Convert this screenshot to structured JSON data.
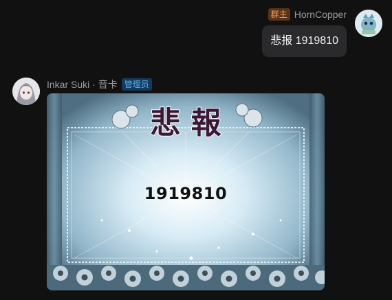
{
  "messages": [
    {
      "side": "right",
      "sender": "HornCopper",
      "role_badge": "群主",
      "text": "悲报 1919810"
    },
    {
      "side": "left",
      "sender": "Inkar Suki · 音卡",
      "role_badge": "管理员",
      "image_card": {
        "title_glyphs": "悲 報",
        "number": "1919810"
      }
    }
  ],
  "colors": {
    "background": "#111112",
    "bubble": "#2a2a2c",
    "owner_badge_text": "#f0a15c",
    "admin_badge_text": "#58aef0"
  }
}
